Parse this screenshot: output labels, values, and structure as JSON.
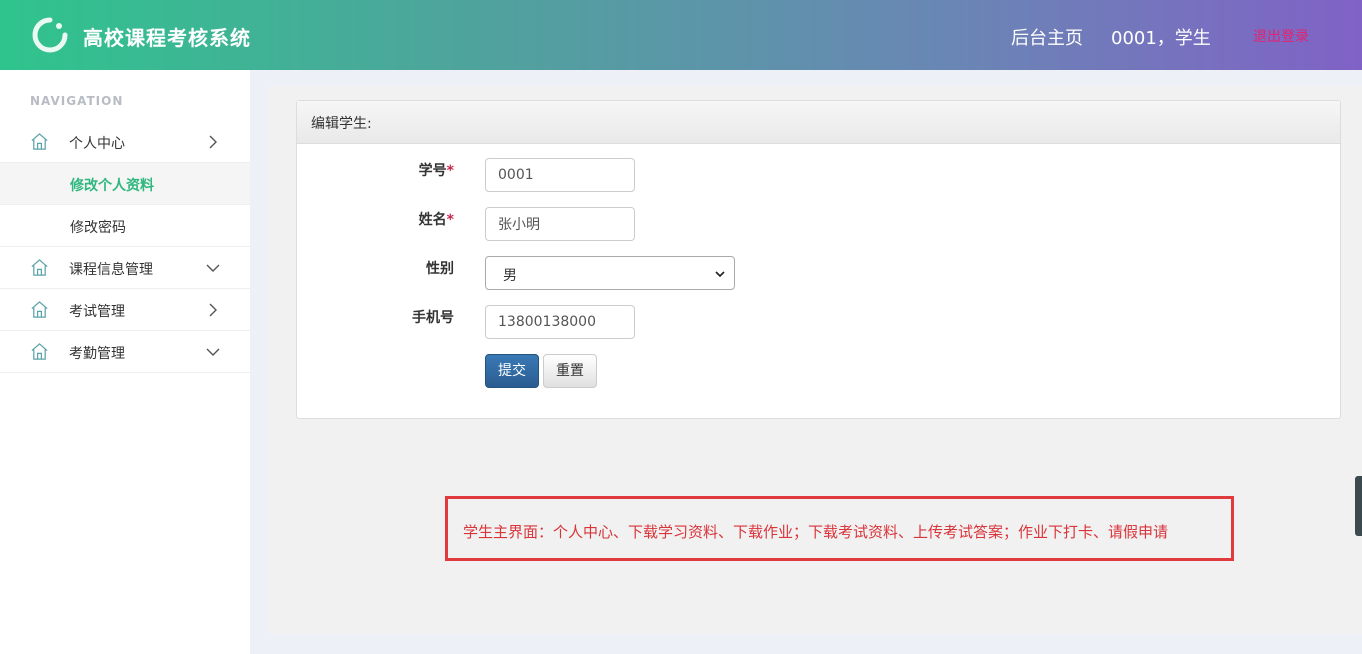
{
  "header": {
    "title": "高校课程考核系统",
    "home_link": "后台主页",
    "user_info": "0001，学生",
    "logout": "退出登录",
    "colors": {
      "gradient_start": "#2fc48d",
      "gradient_end": "#8062c6",
      "logout": "#e2246f"
    }
  },
  "sidebar": {
    "heading": "NAVIGATION",
    "menu": [
      {
        "label": "个人中心",
        "icon": "home-icon",
        "chevron": "chevron-right-icon",
        "children": [
          {
            "label": "修改个人资料",
            "active": true
          },
          {
            "label": "修改密码"
          }
        ]
      },
      {
        "label": "课程信息管理",
        "icon": "home-icon",
        "chevron": "chevron-down-icon"
      },
      {
        "label": "考试管理",
        "icon": "home-icon",
        "chevron": "chevron-right-icon"
      },
      {
        "label": "考勤管理",
        "icon": "home-icon",
        "chevron": "chevron-down-icon"
      }
    ],
    "active_color": "#2fb77f"
  },
  "panel": {
    "heading": "编辑学生:",
    "fields": {
      "student_id": {
        "label": "学号",
        "required": "*",
        "value": "0001"
      },
      "name": {
        "label": "姓名",
        "required": "*",
        "value": "张小明"
      },
      "gender": {
        "label": "性别",
        "value": "男"
      },
      "phone": {
        "label": "手机号",
        "value": "13800138000"
      }
    },
    "submit_label": "提交",
    "reset_label": "重置"
  },
  "notice": {
    "text": "学生主界面：个人中心、下载学习资料、下载作业；下载考试资料、上传考试答案；作业下打卡、请假申请",
    "color": "#d9343a"
  }
}
